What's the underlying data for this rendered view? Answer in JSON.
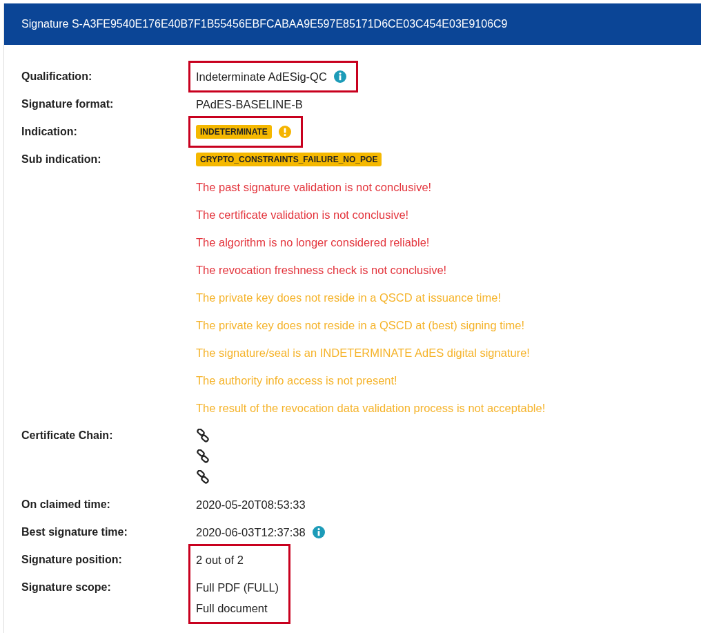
{
  "header": {
    "title": "Signature S-A3FE9540E176E40B7F1B55456EBFCABAA9E597E85171D6CE03C454E03E9106C9"
  },
  "rows": [
    {
      "label": "Qualification:",
      "highlighted": true,
      "items": [
        {
          "kind": "text_info",
          "text": "Indeterminate AdESig-QC"
        }
      ]
    },
    {
      "label": "Signature format:",
      "highlighted": false,
      "items": [
        {
          "kind": "text",
          "text": "PAdES-BASELINE-B"
        }
      ]
    },
    {
      "label": "Indication:",
      "highlighted": true,
      "items": [
        {
          "kind": "badge_alert",
          "text": "INDETERMINATE"
        }
      ]
    },
    {
      "label": "Sub indication:",
      "highlighted": false,
      "items": [
        {
          "kind": "badge",
          "text": "CRYPTO_CONSTRAINTS_FAILURE_NO_POE"
        },
        {
          "kind": "error",
          "text": "The past signature validation is not conclusive!"
        },
        {
          "kind": "error",
          "text": "The certificate validation is not conclusive!"
        },
        {
          "kind": "error",
          "text": "The algorithm is no longer considered reliable!"
        },
        {
          "kind": "error",
          "text": "The revocation freshness check is not conclusive!"
        },
        {
          "kind": "warning",
          "text": "The private key does not reside in a QSCD at issuance time!"
        },
        {
          "kind": "warning",
          "text": "The private key does not reside in a QSCD at (best) signing time!"
        },
        {
          "kind": "warning",
          "text": "The signature/seal is an INDETERMINATE AdES digital signature!"
        },
        {
          "kind": "warning",
          "text": "The authority info access is not present!"
        },
        {
          "kind": "warning",
          "text": "The result of the revocation data validation process is not acceptable!"
        }
      ]
    },
    {
      "label": "Certificate Chain:",
      "highlighted": false,
      "items": [
        {
          "kind": "link"
        },
        {
          "kind": "link"
        },
        {
          "kind": "link"
        }
      ]
    },
    {
      "label": "On claimed time:",
      "highlighted": false,
      "items": [
        {
          "kind": "text",
          "text": "2020-05-20T08:53:33"
        }
      ]
    },
    {
      "label": "Best signature time:",
      "highlighted": false,
      "items": [
        {
          "kind": "text_info",
          "text": "2020-06-03T12:37:38"
        }
      ]
    },
    {
      "label": "Signature position:",
      "highlighted": true,
      "items": [
        {
          "kind": "text",
          "text": "2 out of 2"
        }
      ]
    },
    {
      "label": "Signature scope:",
      "highlighted": true,
      "items": [
        {
          "kind": "text",
          "text": "Full PDF (FULL)"
        },
        {
          "kind": "text",
          "text": "Full document"
        }
      ]
    }
  ]
}
